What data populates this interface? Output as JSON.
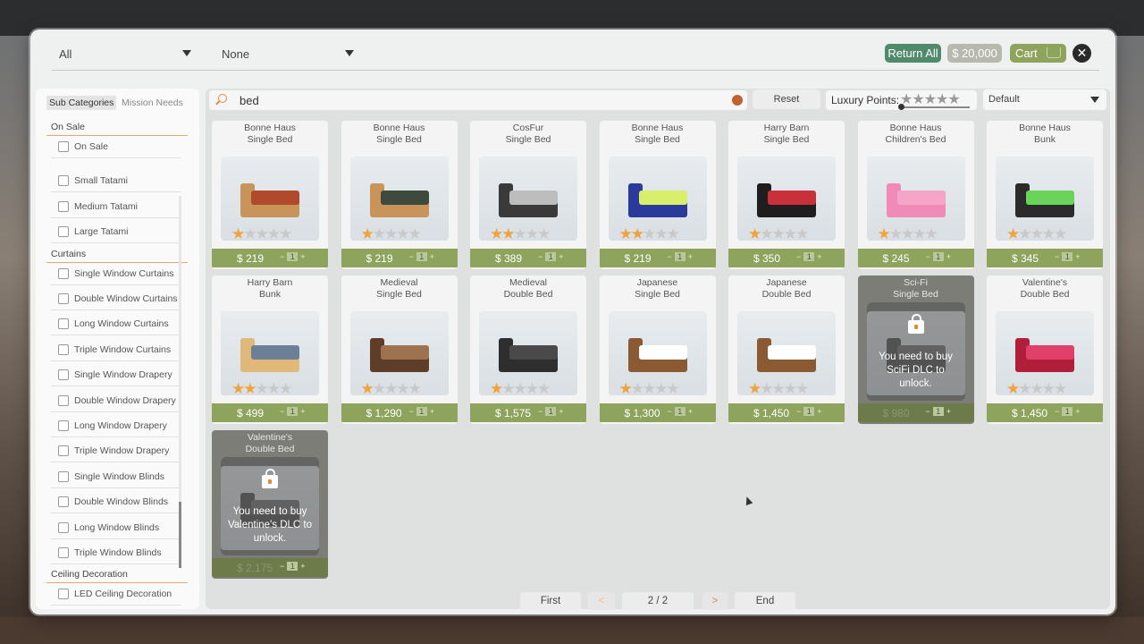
{
  "filters": {
    "category": "All",
    "subfilter": "None"
  },
  "header": {
    "return_all": "Return All",
    "money": "$ 20,000",
    "cart": "Cart",
    "close": "✕"
  },
  "sidebar": {
    "tabs": [
      "Sub Categories",
      "Mission Needs"
    ],
    "sections": [
      {
        "title": "On Sale",
        "items": [
          "On Sale"
        ]
      },
      {
        "title": "",
        "items": [
          "Small Tatami",
          "Medium Tatami",
          "Large Tatami"
        ]
      },
      {
        "title": "Curtains",
        "items": [
          "Single Window Curtains",
          "Double Window Curtains",
          "Long Window Curtains",
          "Triple Window Curtains",
          "Single Window Drapery",
          "Double Window Drapery",
          "Long Window Drapery",
          "Triple Window Drapery",
          "Single Window Blinds",
          "Double Window Blinds",
          "Long Window Blinds",
          "Triple Window Blinds"
        ]
      },
      {
        "title": "Ceiling Decoration",
        "items": [
          "LED Ceiling Decoration"
        ]
      }
    ]
  },
  "search": {
    "query": "bed"
  },
  "toolbar": {
    "reset": "Reset",
    "luxury_label": "Luxury Points:",
    "luxury_stars": "★★★★★",
    "sort": "Default"
  },
  "items": [
    {
      "brand": "Bonne Haus",
      "name": "Single Bed",
      "price": "$ 219",
      "rating": 1,
      "qty": "1",
      "locked": false,
      "color": "#c9945a",
      "mat": "#b04a2a"
    },
    {
      "brand": "Bonne Haus",
      "name": "Single Bed",
      "price": "$ 219",
      "rating": 1,
      "qty": "1",
      "locked": false,
      "color": "#c9945a",
      "mat": "#3e4a3e"
    },
    {
      "brand": "CosFur",
      "name": "Single Bed",
      "price": "$ 389",
      "rating": 2,
      "qty": "1",
      "locked": false,
      "color": "#3a3a3a",
      "mat": "#bdbdbd"
    },
    {
      "brand": "Bonne Haus",
      "name": "Single Bed",
      "price": "$ 219",
      "rating": 2,
      "qty": "1",
      "locked": false,
      "color": "#2a3a9a",
      "mat": "#d9ee6a"
    },
    {
      "brand": "Harry Barn",
      "name": "Single Bed",
      "price": "$ 350",
      "rating": 1,
      "qty": "1",
      "locked": false,
      "color": "#1e1e1e",
      "mat": "#c9303a"
    },
    {
      "brand": "Bonne Haus",
      "name": "Children's Bed",
      "price": "$ 245",
      "rating": 1,
      "qty": "1",
      "locked": false,
      "color": "#f08ab6",
      "mat": "#f5a6c8"
    },
    {
      "brand": "Bonne Haus",
      "name": "Bunk",
      "price": "$ 345",
      "rating": 1,
      "qty": "1",
      "locked": false,
      "color": "#2b2b2b",
      "mat": "#6ad45a"
    },
    {
      "brand": "Harry Barn",
      "name": "Bunk",
      "price": "$ 499",
      "rating": 2,
      "qty": "1",
      "locked": false,
      "color": "#e0b87a",
      "mat": "#6b7f96"
    },
    {
      "brand": "Medieval",
      "name": "Single Bed",
      "price": "$ 1,290",
      "rating": 1,
      "qty": "1",
      "locked": false,
      "color": "#5e3e28",
      "mat": "#9c7250"
    },
    {
      "brand": "Medieval",
      "name": "Double Bed",
      "price": "$ 1,575",
      "rating": 1,
      "qty": "1",
      "locked": false,
      "color": "#2e2e2e",
      "mat": "#4a4a4a"
    },
    {
      "brand": "Japanese",
      "name": "Single Bed",
      "price": "$ 1,300",
      "rating": 1,
      "qty": "1",
      "locked": false,
      "color": "#8b5a32",
      "mat": "#ffffff"
    },
    {
      "brand": "Japanese",
      "name": "Double Bed",
      "price": "$ 1,450",
      "rating": 1,
      "qty": "1",
      "locked": false,
      "color": "#8b5a32",
      "mat": "#ffffff"
    },
    {
      "brand": "Sci-Fi",
      "name": "Single Bed",
      "price": "$ 980",
      "rating": 0,
      "qty": "1",
      "locked": true,
      "lock_msg": "You need to buy SciFi DLC to unlock.",
      "color": "#555",
      "mat": "#777"
    },
    {
      "brand": "Valentine's",
      "name": "Double Bed",
      "price": "$ 1,450",
      "rating": 1,
      "qty": "1",
      "locked": false,
      "color": "#b01e3a",
      "mat": "#e0406a"
    },
    {
      "brand": "Valentine's",
      "name": "Double Bed",
      "price": "$ 2,175",
      "rating": 0,
      "qty": "1",
      "locked": true,
      "lock_msg": "You need to buy Valentine's DLC to unlock.",
      "color": "#555",
      "mat": "#777"
    }
  ],
  "pagination": {
    "first": "First",
    "prev": "<",
    "page": "2 / 2",
    "next": ">",
    "end": "End"
  }
}
